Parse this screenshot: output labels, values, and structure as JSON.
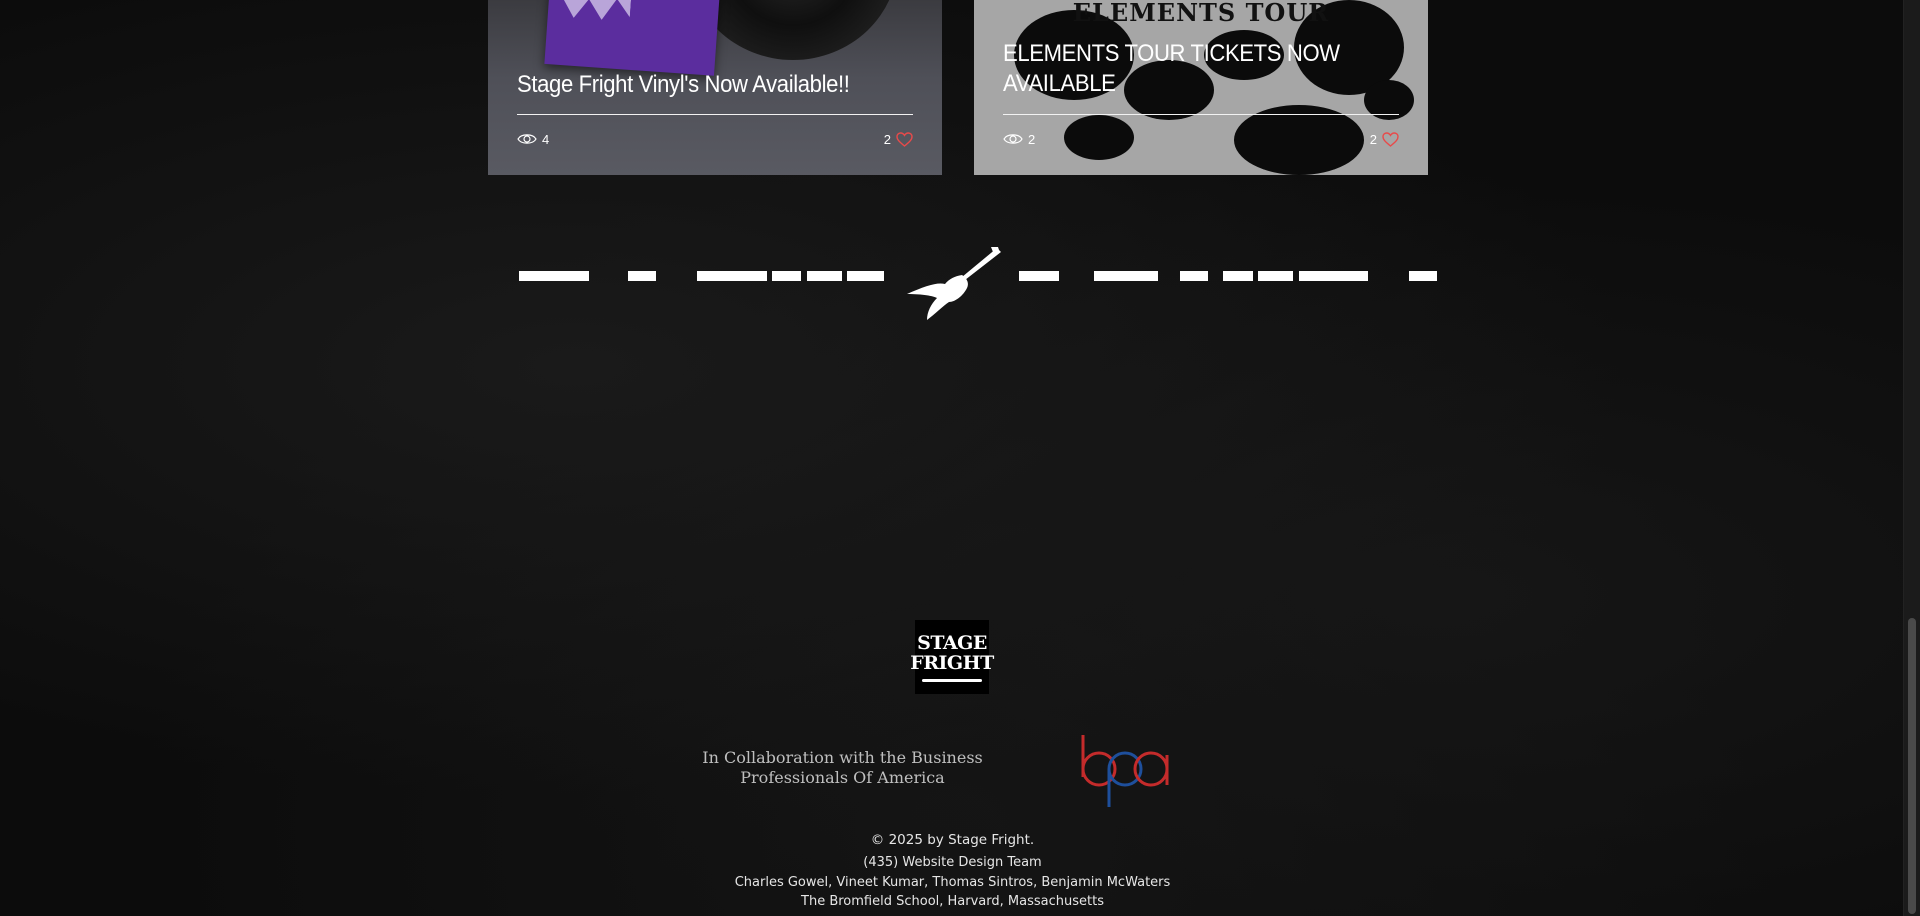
{
  "posts": [
    {
      "title": "Stage Fright Vinyl's Now Available!!",
      "views": "4",
      "likes": "2"
    },
    {
      "image_title": "ELEMENTS TOUR",
      "title": "ELEMENTS TOUR TICKETS NOW AVAILABLE",
      "views": "2",
      "likes": "2"
    }
  ],
  "icons": {
    "views": "eye-icon",
    "likes": "heart-icon",
    "marquee": "guitar-icon"
  },
  "footer": {
    "logo_line_1": "STAGE",
    "logo_line_2": "FRIGHT",
    "collab_text": "In Collaboration with the Business Professionals Of America",
    "bpa_logo_text": "bpa",
    "copyright": "© 2025 by Stage Fright.",
    "team": "(435) Website Design Team",
    "members": "Charles Gowel, Vineet Kumar, Thomas Sintros, Benjamin McWaters",
    "school": "The Bromfield School, Harvard, Massachusetts"
  },
  "colors": {
    "like_heart": "#e84a4a",
    "bpa_red": "#c42b2b",
    "bpa_blue": "#1e4f9c",
    "sleeve_purple": "#5b2d9e"
  }
}
